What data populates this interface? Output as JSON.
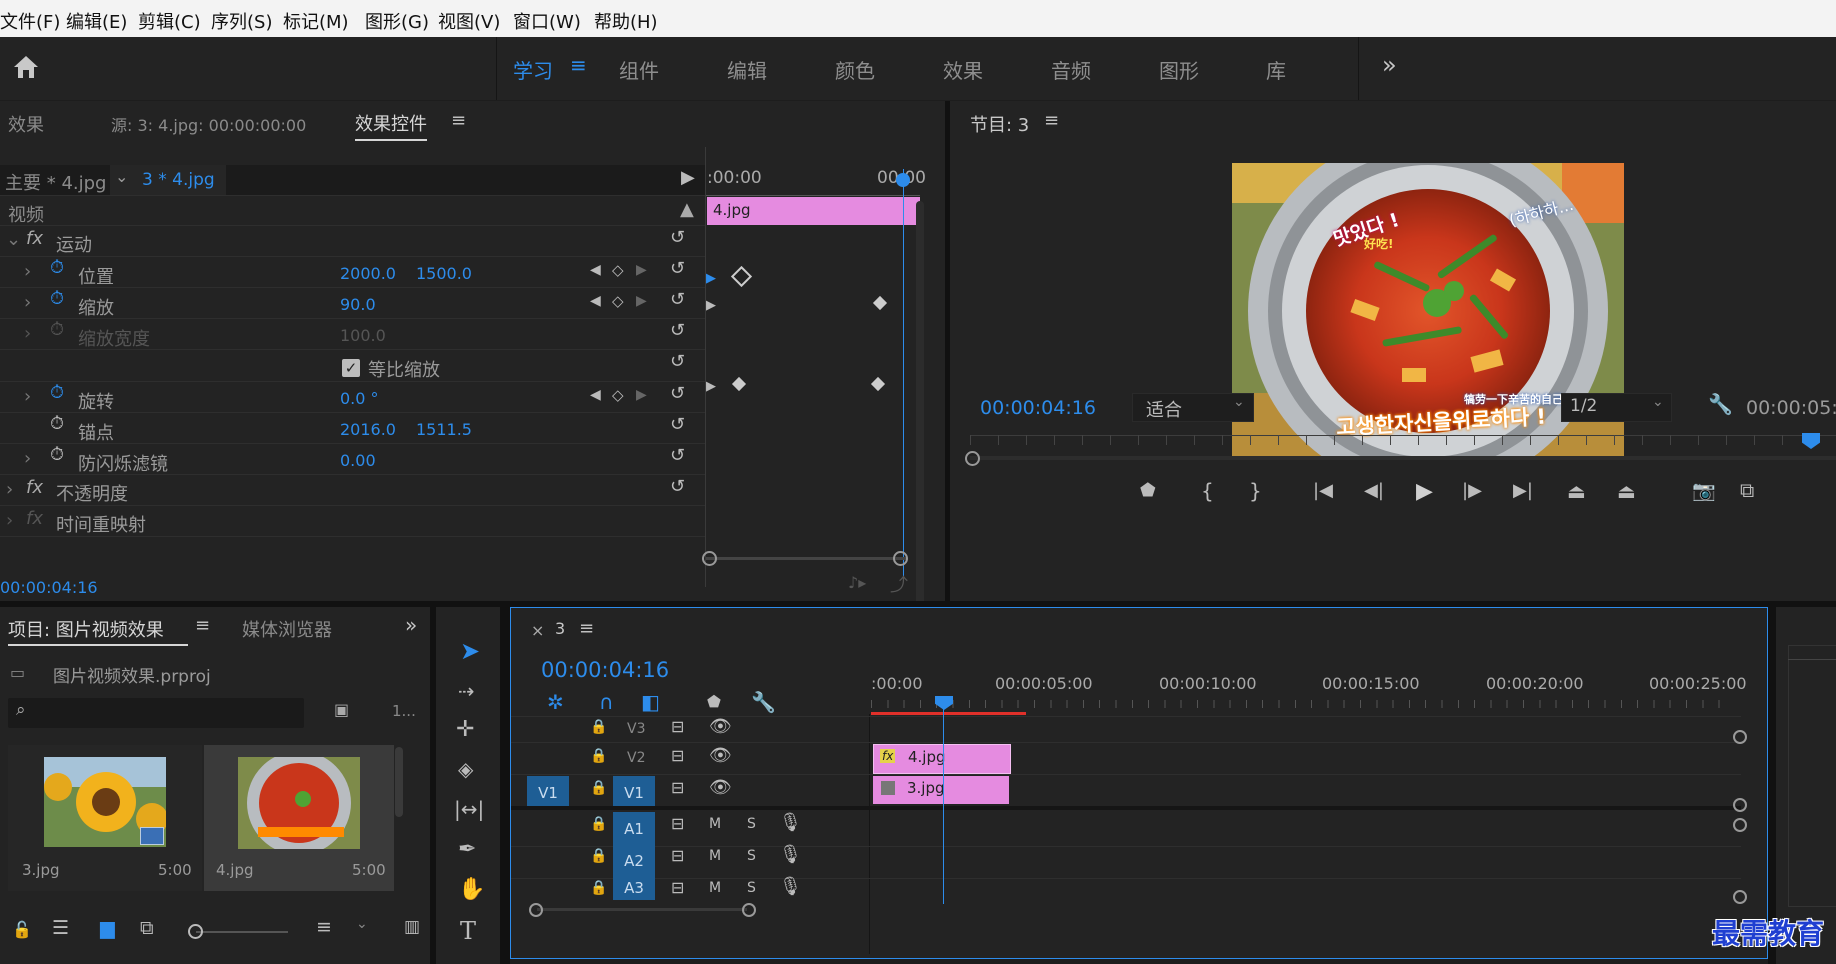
{
  "menu": [
    "文件(F)",
    "编辑(E)",
    "剪辑(C)",
    "序列(S)",
    "标记(M)",
    "图形(G)",
    "视图(V)",
    "窗口(W)",
    "帮助(H)"
  ],
  "workspaces": {
    "items": [
      "学习",
      "组件",
      "编辑",
      "颜色",
      "效果",
      "音频",
      "图形",
      "库"
    ],
    "active": "学习",
    "more": "»"
  },
  "effect_controls": {
    "tab_effects": "效果",
    "tab_source": "源: 3: 4.jpg: 00:00:00:00",
    "tab_active": "效果控件",
    "master_clip": "主要 * 4.jpg",
    "seq_clip": "3 * 4.jpg",
    "ruler_start": ":00:00",
    "ruler_end": "00:00",
    "clip_label": "4.jpg",
    "section_video": "视频",
    "motion": "运动",
    "position_label": "位置",
    "position_x": "2000.0",
    "position_y": "1500.0",
    "scale_label": "缩放",
    "scale_value": "90.0",
    "scale_width_label": "缩放宽度",
    "scale_width_value": "100.0",
    "uniform_scale_label": "等比缩放",
    "uniform_scale_checked": true,
    "rotation_label": "旋转",
    "rotation_value": "0.0 °",
    "anchor_label": "锚点",
    "anchor_x": "2016.0",
    "anchor_y": "1511.5",
    "antiflicker_label": "防闪烁滤镜",
    "antiflicker_value": "0.00",
    "opacity": "不透明度",
    "time_remap": "时间重映射",
    "timecode": "00:00:04:16"
  },
  "program": {
    "title": "节目: 3",
    "timecode": "00:00:04:16",
    "fit": "适合",
    "resolution": "1/2",
    "duration": "00:00:05:",
    "overlay_text_1": "맛있다 !",
    "overlay_text_2": "好吃!",
    "overlay_text_3": "(하하하...",
    "overlay_text_4": "犒劳一下辛苦的自己!",
    "overlay_text_5": "고생한자신을위로하다 !"
  },
  "project": {
    "title": "项目: 图片视频效果",
    "tab_media": "媒体浏览器",
    "file": "图片视频效果.prproj",
    "items_count": "1...",
    "items": [
      {
        "name": "3.jpg",
        "dur": "5:00"
      },
      {
        "name": "4.jpg",
        "dur": "5:00"
      }
    ]
  },
  "timeline": {
    "tab": "3",
    "timecode": "00:00:04:16",
    "ruler": [
      ":00:00",
      "00:00:05:00",
      "00:00:10:00",
      "00:00:15:00",
      "00:00:20:00",
      "00:00:25:00"
    ],
    "tracks_video": [
      "V3",
      "V2",
      "V1"
    ],
    "src_patch_v": "V1",
    "tracks_audio": [
      "A1",
      "A2",
      "A3"
    ],
    "mute_label": "M",
    "solo_label": "S",
    "clip_v2": "4.jpg",
    "clip_v1": "3.jpg",
    "fx_badge": "fx"
  },
  "watermark": "最需教育",
  "colors": {
    "accent": "#2d8ceb",
    "clip": "#e58be0",
    "track_blue": "#1e5e95",
    "playhead": "#2d8ceb"
  }
}
